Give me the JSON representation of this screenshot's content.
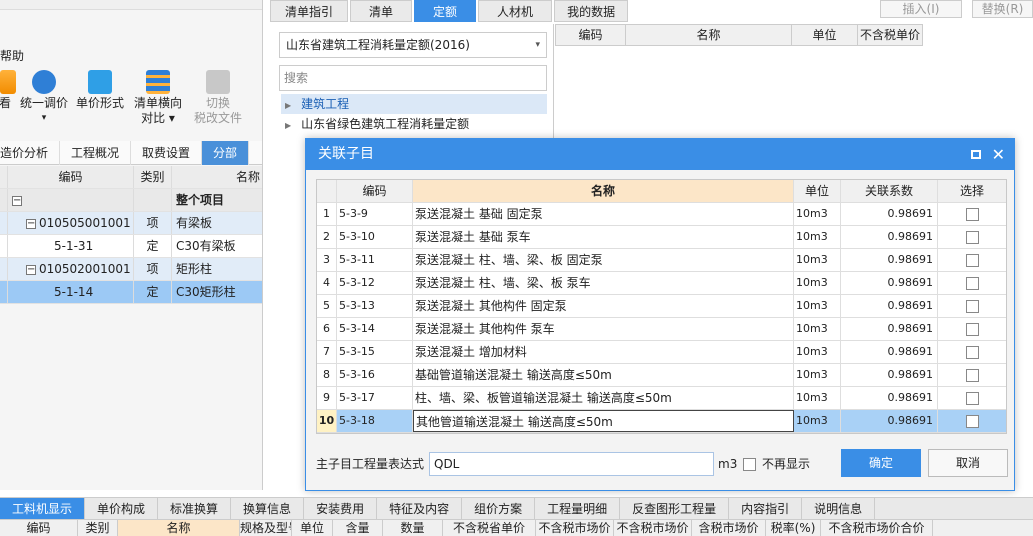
{
  "left_panel": {
    "help_menu": "帮助",
    "toolbar": [
      {
        "label": "看",
        "sub": ""
      },
      {
        "label": "统一调价",
        "sub": "▾"
      },
      {
        "label": "单价形式",
        "sub": ""
      },
      {
        "label": "清单横向",
        "sub": "对比 ▾"
      },
      {
        "label": "切换",
        "sub": "税改文件"
      }
    ],
    "tabs": [
      "造价分析",
      "工程概况",
      "取费设置",
      "分部"
    ],
    "grid_headers": [
      "编码",
      "类别",
      "名称"
    ],
    "rows": [
      {
        "code": "",
        "type": "",
        "name": "整个项目"
      },
      {
        "code": "010505001001",
        "type": "项",
        "name": "有梁板"
      },
      {
        "code": "5-1-31",
        "type": "定",
        "name": "C30有梁板"
      },
      {
        "code": "010502001001",
        "type": "项",
        "name": "矩形柱"
      },
      {
        "code": "5-1-14",
        "type": "定",
        "name": "C30矩形柱"
      }
    ]
  },
  "right_panel": {
    "tabs": [
      "清单指引",
      "清单",
      "定额",
      "人材机",
      "我的数据"
    ],
    "insert_label": "插入(I)",
    "replace_label": "替换(R)",
    "quota_select": "山东省建筑工程消耗量定额(2016)",
    "search_placeholder": "搜索",
    "tree": [
      "建筑工程",
      "山东省绿色建筑工程消耗量定额"
    ],
    "table_headers": [
      "编码",
      "名称",
      "单位",
      "不含税单价"
    ]
  },
  "dialog": {
    "title": "关联子目",
    "headers": [
      "",
      "编码",
      "名称",
      "单位",
      "关联系数",
      "选择"
    ],
    "rows": [
      {
        "n": "1",
        "code": "5-3-9",
        "name": "泵送混凝土 基础 固定泵",
        "unit": "10m3",
        "coef": "0.98691"
      },
      {
        "n": "2",
        "code": "5-3-10",
        "name": "泵送混凝土 基础 泵车",
        "unit": "10m3",
        "coef": "0.98691"
      },
      {
        "n": "3",
        "code": "5-3-11",
        "name": "泵送混凝土 柱、墙、梁、板 固定泵",
        "unit": "10m3",
        "coef": "0.98691"
      },
      {
        "n": "4",
        "code": "5-3-12",
        "name": "泵送混凝土 柱、墙、梁、板 泵车",
        "unit": "10m3",
        "coef": "0.98691"
      },
      {
        "n": "5",
        "code": "5-3-13",
        "name": "泵送混凝土 其他构件 固定泵",
        "unit": "10m3",
        "coef": "0.98691"
      },
      {
        "n": "6",
        "code": "5-3-14",
        "name": "泵送混凝土 其他构件 泵车",
        "unit": "10m3",
        "coef": "0.98691"
      },
      {
        "n": "7",
        "code": "5-3-15",
        "name": "泵送混凝土 增加材料",
        "unit": "10m3",
        "coef": "0.98691"
      },
      {
        "n": "8",
        "code": "5-3-16",
        "name": "基础管道输送混凝土 输送高度≤50m",
        "unit": "10m3",
        "coef": "0.98691"
      },
      {
        "n": "9",
        "code": "5-3-17",
        "name": "柱、墙、梁、板管道输送混凝土 输送高度≤50m",
        "unit": "10m3",
        "coef": "0.98691"
      },
      {
        "n": "10",
        "code": "5-3-18",
        "name": "其他管道输送混凝土 输送高度≤50m",
        "unit": "10m3",
        "coef": "0.98691"
      }
    ],
    "expr_label": "主子目工程量表达式",
    "expr_value": "QDL",
    "expr_unit": "m3",
    "no_show_label": "不再显示",
    "ok_label": "确定",
    "cancel_label": "取消"
  },
  "bottom": {
    "tabs": [
      "工料机显示",
      "单价构成",
      "标准换算",
      "换算信息",
      "安装费用",
      "特征及内容",
      "组价方案",
      "工程量明细",
      "反查图形工程量",
      "内容指引",
      "说明信息"
    ],
    "headers": [
      "编码",
      "类别",
      "名称",
      "规格及型号",
      "单位",
      "含量",
      "数量",
      "不含税省单价",
      "不含税市场价",
      "不含税市场价",
      "含税市场价",
      "税率(%)",
      "不含税市场价合价"
    ]
  },
  "colors": {
    "accent": "#3a8ee6",
    "selected_row": "#9cc9f5"
  }
}
